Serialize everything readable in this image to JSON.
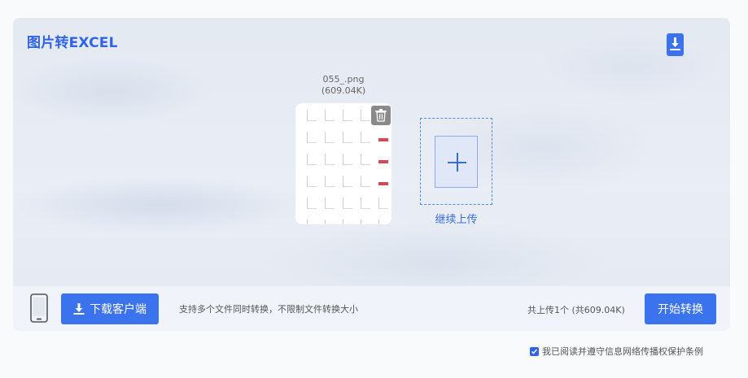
{
  "app": {
    "title": "图片转EXCEL"
  },
  "file": {
    "name": "055_.png",
    "size": "(609.04K)"
  },
  "upload": {
    "continue_label": "继续上传"
  },
  "bottom": {
    "client_button_label": "下载客户端",
    "hint": "支持多个文件同时转换，不限制文件转换大小",
    "total": "共上传1个 (共609.04K)",
    "start_button_label": "开始转换"
  },
  "agreement": {
    "text": "我已阅读并遵守信息网络传播权保护条例",
    "checked": true
  },
  "colors": {
    "accent": "#3b73ee",
    "title": "#2f64e8"
  },
  "icons": {
    "corner": "download-icon",
    "trash": "trash-icon",
    "add": "plus-icon",
    "phone": "phone-icon",
    "client": "download-icon"
  }
}
